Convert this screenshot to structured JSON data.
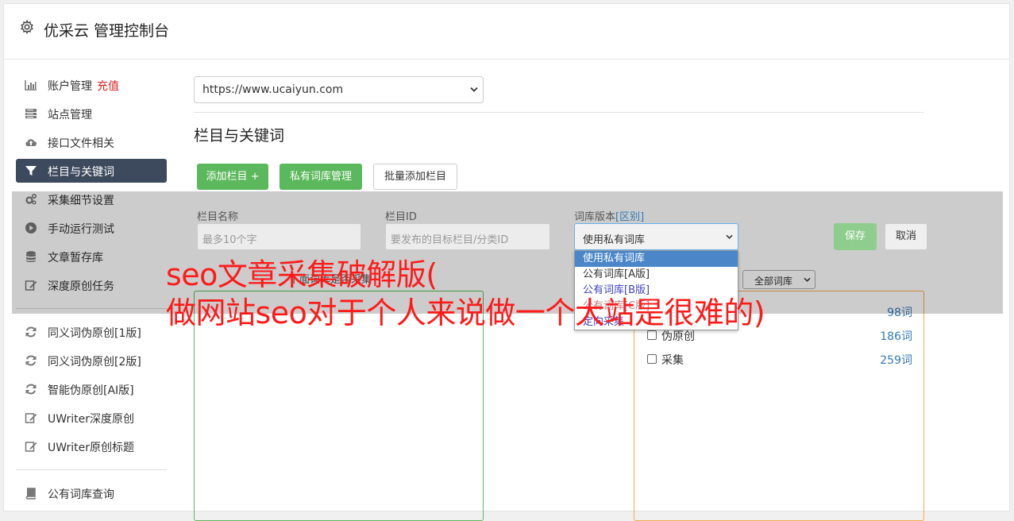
{
  "header": {
    "title": "优采云 管理控制台",
    "icon": "gear-icon"
  },
  "sidebar": {
    "items": [
      {
        "label": "账户管理",
        "extra": "充值",
        "icon": "bar-chart-icon",
        "active": false
      },
      {
        "label": "站点管理",
        "icon": "server-icon",
        "active": false
      },
      {
        "label": "接口文件相关",
        "icon": "cloud-upload-icon",
        "active": false
      },
      {
        "label": "栏目与关键词",
        "icon": "filter-icon",
        "active": true
      },
      {
        "label": "采集细节设置",
        "icon": "cogs-icon",
        "active": false
      },
      {
        "label": "手动运行测试",
        "icon": "play-circle-icon",
        "active": false
      },
      {
        "label": "文章暂存库",
        "icon": "database-icon",
        "active": false
      },
      {
        "label": "深度原创任务",
        "icon": "edit-icon",
        "active": false
      }
    ],
    "items2": [
      {
        "label": "同义词伪原创[1版]",
        "icon": "refresh-icon"
      },
      {
        "label": "同义词伪原创[2版]",
        "icon": "refresh-icon"
      },
      {
        "label": "智能伪原创[AI版]",
        "icon": "refresh-icon"
      },
      {
        "label": "UWriter深度原创",
        "icon": "edit-icon"
      },
      {
        "label": "UWriter原创标题",
        "icon": "edit-icon"
      }
    ],
    "items3": [
      {
        "label": "公有词库查询",
        "icon": "book-icon"
      }
    ]
  },
  "main": {
    "site_select": {
      "value": "https://www.ucaiyun.com"
    },
    "section_title": "栏目与关键词",
    "buttons": {
      "add_column": "添加栏目 +",
      "private_lib": "私有词库管理",
      "batch_add": "批量添加栏目"
    },
    "form": {
      "name_label": "栏目名称",
      "name_placeholder": "最多10个字",
      "id_label": "栏目ID",
      "id_placeholder": "要发布的目标栏目/分类ID",
      "version_label": "词库版本",
      "version_link": "[区别]",
      "version_value": "使用私有词库",
      "save": "保存",
      "cancel": "取消"
    },
    "dropdown_options": [
      "使用私有词库",
      "公有词库[A版]",
      "公有词库[B版]",
      "公有词库[C版]",
      "定向采集"
    ],
    "hidden_label": "下面词库是否采集",
    "filter_select": "全部词库",
    "libraries": [
      {
        "name": "",
        "count": "98词"
      },
      {
        "name": "伪原创",
        "count": "186词"
      },
      {
        "name": "采集",
        "count": "259词"
      }
    ]
  },
  "watermark": {
    "line1": "seo文章采集破解版(",
    "line2": "做网站seo对于个人来说做一个大站是很难的)"
  },
  "colors": {
    "primary_green": "#5cb85c",
    "sidebar_active": "#3d4a5d",
    "link_blue": "#337ab7",
    "watermark_red": "#ff1a1a"
  }
}
